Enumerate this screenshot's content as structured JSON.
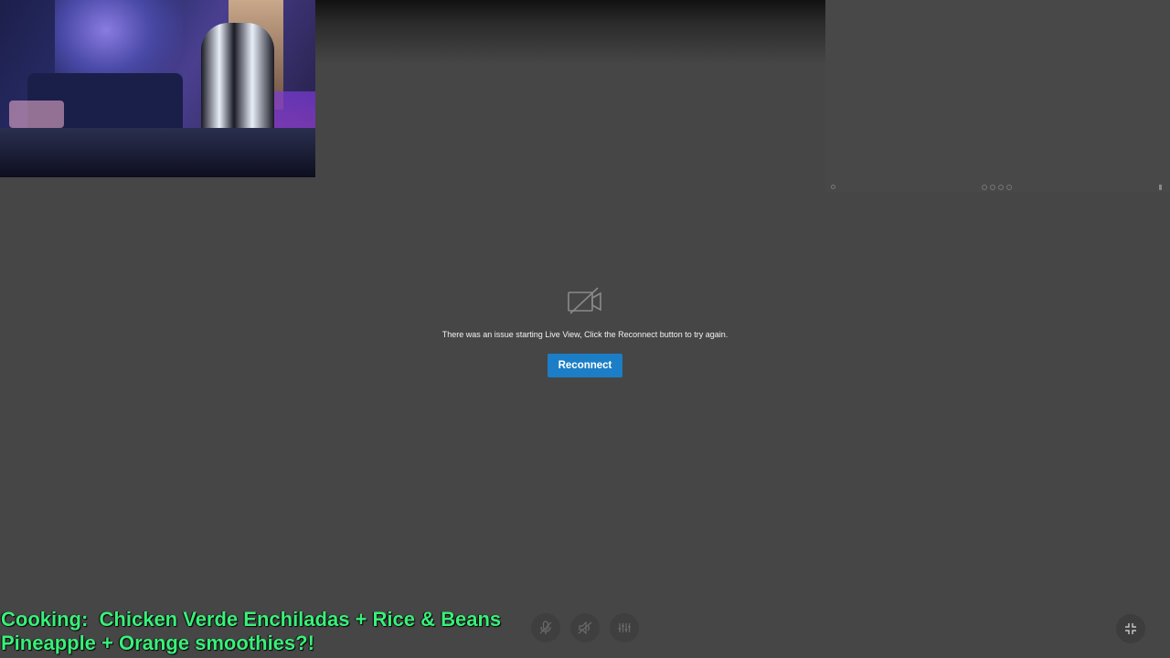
{
  "webcam": {
    "icon": "webcam-feed"
  },
  "mini_preview": {
    "title": "",
    "subtitle": "",
    "message": ""
  },
  "live_view": {
    "camera_off_icon": "video-off-icon",
    "error_message": "There was an issue starting Live View, Click the Reconnect button to try again.",
    "reconnect_label": "Reconnect",
    "accent_color": "#1b7ec6"
  },
  "caption": {
    "line1": "Cooking:  Chicken Verde Enchiladas + Rice & Beans",
    "line2": "Pineapple + Orange smoothies?!",
    "color": "#39f07a"
  },
  "controls": {
    "items": [
      {
        "icon": "microphone-off-icon"
      },
      {
        "icon": "speaker-off-icon"
      },
      {
        "icon": "sliders-icon"
      }
    ],
    "fullscreen_icon": "exit-fullscreen-icon"
  }
}
